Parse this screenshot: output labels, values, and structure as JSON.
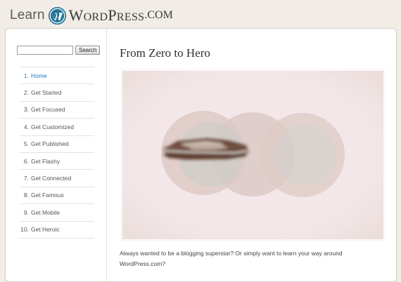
{
  "brand": {
    "learn": "Learn",
    "wp_initial": "W",
    "wp_rest": "ORD",
    "wp_initial2": "P",
    "wp_rest2": "RESS",
    "dotcom": ".COM",
    "logo_icon": "wordpress-logo-icon"
  },
  "search": {
    "placeholder": "",
    "button": "Search"
  },
  "nav": [
    {
      "num": "1.",
      "label": "Home"
    },
    {
      "num": "2.",
      "label": "Get Started"
    },
    {
      "num": "3.",
      "label": "Get Focused"
    },
    {
      "num": "4.",
      "label": "Get Customized"
    },
    {
      "num": "5.",
      "label": "Get Published"
    },
    {
      "num": "6.",
      "label": "Get Flashy"
    },
    {
      "num": "7.",
      "label": "Get Connected"
    },
    {
      "num": "8.",
      "label": "Get Famous"
    },
    {
      "num": "9.",
      "label": "Get Mobile"
    },
    {
      "num": "10.",
      "label": "Get Heroic"
    }
  ],
  "active_index": 0,
  "page": {
    "title": "From Zero to Hero",
    "intro": "Always wanted to be a blogging superstar? Or simply want to learn your way around WordPress.com?"
  },
  "colors": {
    "link": "#2a78b5",
    "background": "#f1ede6",
    "hero_bg": "#f3e6e8"
  }
}
